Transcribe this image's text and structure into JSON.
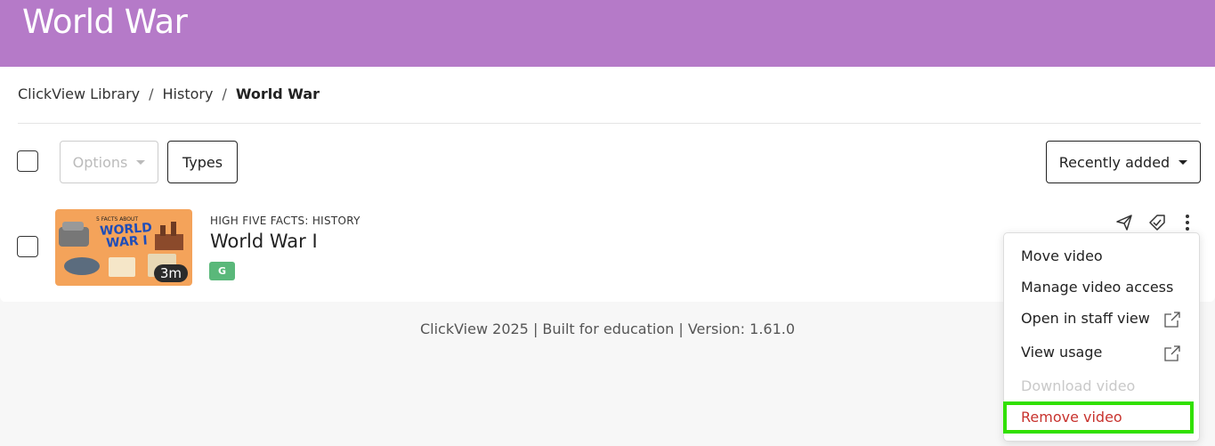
{
  "header": {
    "title": "World War"
  },
  "breadcrumb": {
    "items": [
      "ClickView Library",
      "History",
      "World War"
    ],
    "separator": "/"
  },
  "toolbar": {
    "options_label": "Options",
    "types_label": "Types",
    "sort_label": "Recently added"
  },
  "video": {
    "series": "HIGH FIVE FACTS: HISTORY",
    "title": "World War I",
    "rating": "G",
    "duration": "3m",
    "thumbnail_text": "WORLD WAR I",
    "thumbnail_subtext": "5 FACTS ABOUT"
  },
  "footer": {
    "text": "ClickView 2025 | Built for education | Version: 1.61.0"
  },
  "menu": {
    "items": [
      {
        "label": "Move video"
      },
      {
        "label": "Manage video access"
      },
      {
        "label": "Open in staff view"
      },
      {
        "label": "View usage"
      },
      {
        "label": "Download video"
      },
      {
        "label": "Remove video"
      }
    ]
  },
  "colors": {
    "banner": "#b57ac8",
    "rating": "#5ab87a",
    "danger": "#c8332e",
    "highlight": "#31e000"
  }
}
